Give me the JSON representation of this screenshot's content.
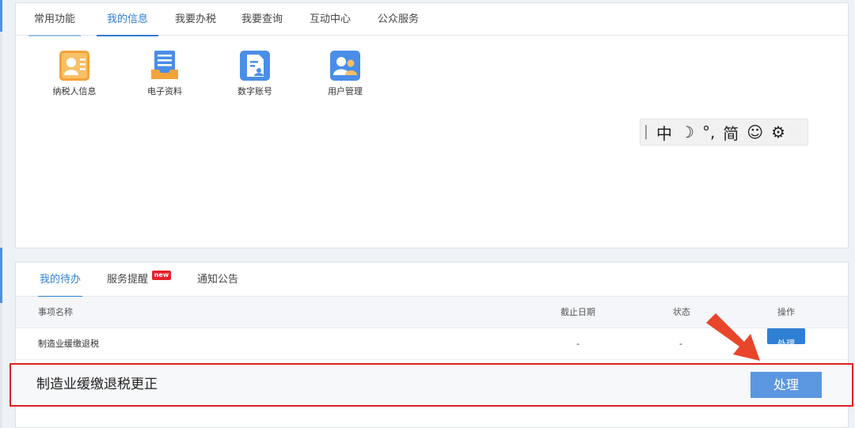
{
  "top_tabs": [
    {
      "label": "常用功能"
    },
    {
      "label": "我的信息"
    },
    {
      "label": "我要办税"
    },
    {
      "label": "我要查询"
    },
    {
      "label": "互动中心"
    },
    {
      "label": "公众服务"
    }
  ],
  "functions": [
    {
      "label": "纳税人信息",
      "icon": "taxpayer-info-icon",
      "color": "#f2a33a"
    },
    {
      "label": "电子资料",
      "icon": "electronic-docs-icon",
      "color": "#f2a33a"
    },
    {
      "label": "数字账号",
      "icon": "digital-account-icon",
      "color": "#4a8ee8"
    },
    {
      "label": "用户管理",
      "icon": "user-management-icon",
      "color": "#4a8ee8"
    }
  ],
  "ime_toolbar": {
    "chinese": "中",
    "moon": "☽",
    "punct": "°,",
    "simplified": "简",
    "smile": "☺",
    "gear": "⚙"
  },
  "bottom_tabs": [
    {
      "label": "我的待办"
    },
    {
      "label": "服务提醒",
      "badge": "new"
    },
    {
      "label": "通知公告"
    }
  ],
  "table": {
    "headers": {
      "name": "事项名称",
      "deadline": "截止日期",
      "status": "状态",
      "action": "操作"
    },
    "rows": [
      {
        "name": "制造业缓缴退税",
        "deadline": "-",
        "status": "-",
        "action": "处理"
      }
    ]
  },
  "highlight": {
    "text": "制造业缓缴退税更正",
    "button": "处理"
  },
  "colors": {
    "accent": "#2f7fd3",
    "highlight_border": "#e02020",
    "arrow": "#e8452a"
  }
}
